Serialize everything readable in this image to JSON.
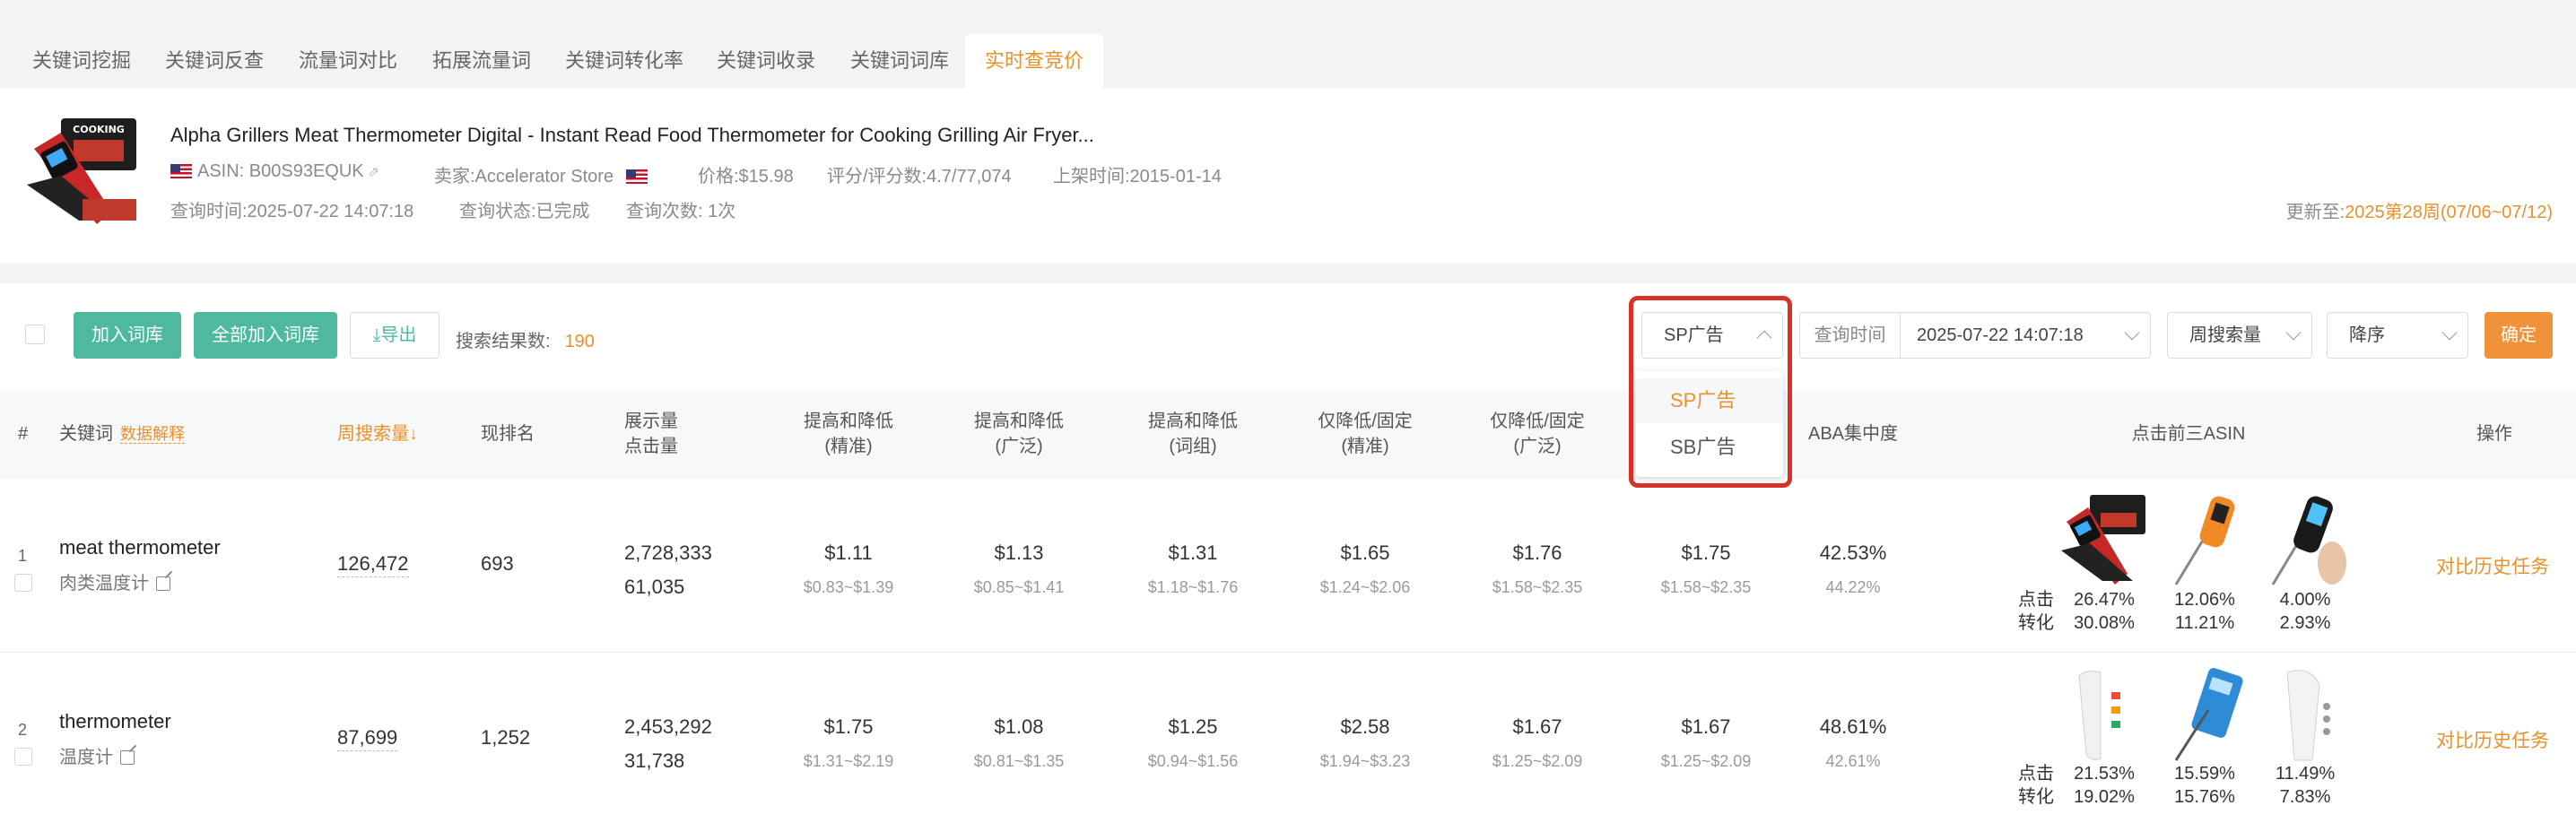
{
  "tabs": [
    "关键词挖掘",
    "关键词反查",
    "流量词对比",
    "拓展流量词",
    "关键词转化率",
    "关键词收录",
    "关键词词库",
    "实时查竞价"
  ],
  "product": {
    "title": "Alpha Grillers Meat Thermometer Digital - Instant Read Food Thermometer for Cooking Grilling Air Fryer...",
    "asin": "ASIN: B00S93EQUK",
    "seller": "卖家:Accelerator Store",
    "price": "价格:$15.98",
    "rating": "评分/评分数:4.7/77,074",
    "listed": "上架时间:2015-01-14",
    "query_time": "查询时间:2025-07-22 14:07:18",
    "query_status": "查询状态:已完成",
    "query_count": "查询次数: 1次",
    "update_label": "更新至:",
    "update_value": "2025第28周(07/06~07/12)"
  },
  "toolbar": {
    "add_label": "加入词库",
    "add_all_label": "全部加入词库",
    "export_label": "导出",
    "count_label": "搜索结果数:",
    "count_value": "190",
    "ad_type": "SP广告",
    "query_time_label": "查询时间",
    "query_time_value": "2025-07-22 14:07:18",
    "sort_field": "周搜索量",
    "sort_order": "降序",
    "confirm_label": "确定"
  },
  "dropdown": {
    "options": [
      "SP广告",
      "SB广告"
    ],
    "selected": "SP广告"
  },
  "columns": {
    "num": "#",
    "keyword": "关键词",
    "keyword_tip": "数据解释",
    "weekly": "周搜索量↓",
    "rank": "现排名",
    "impr1": "展示量",
    "impr2": "点击量",
    "exact1": "提高和降低",
    "exact2": "(精准)",
    "broad1": "提高和降低",
    "broad2": "(广泛)",
    "phrase1": "提高和降低",
    "phrase2": "(词组)",
    "fexact1": "仅降低/固定",
    "fexact2": "(精准)",
    "fbroad1": "仅降低/固定",
    "fbroad2": "(广泛)",
    "aba": "ABA集中度",
    "top3": "点击前三ASIN",
    "action": "操作"
  },
  "rows": [
    {
      "idx": "1",
      "keyword": "meat thermometer",
      "keyword_cn": "肉类温度计",
      "weekly": "126,472",
      "rank": "693",
      "impressions": "2,728,333",
      "clicks": "61,035",
      "exact": "$1.11",
      "exact_range": "$0.83~$1.39",
      "broad": "$1.13",
      "broad_range": "$0.85~$1.41",
      "phrase": "$1.31",
      "phrase_range": "$1.18~$1.76",
      "fexact": "$1.65",
      "fexact_range": "$1.24~$2.06",
      "fbroad": "$1.76",
      "fbroad_range": "$1.58~$2.35",
      "fphrase": "$1.75",
      "fphrase_range": "$1.58~$2.35",
      "aba": "42.53%",
      "aba_sub": "44.22%",
      "click_label": "点击",
      "conv_label": "转化",
      "asins": [
        {
          "click": "26.47%",
          "conv": "30.08%"
        },
        {
          "click": "12.06%",
          "conv": "11.21%"
        },
        {
          "click": "4.00%",
          "conv": "2.93%"
        }
      ],
      "action": "对比历史任务"
    },
    {
      "idx": "2",
      "keyword": "thermometer",
      "keyword_cn": "温度计",
      "weekly": "87,699",
      "rank": "1,252",
      "impressions": "2,453,292",
      "clicks": "31,738",
      "exact": "$1.75",
      "exact_range": "$1.31~$2.19",
      "broad": "$1.08",
      "broad_range": "$0.81~$1.35",
      "phrase": "$1.25",
      "phrase_range": "$0.94~$1.56",
      "fexact": "$2.58",
      "fexact_range": "$1.94~$3.23",
      "fbroad": "$1.67",
      "fbroad_range": "$1.25~$2.09",
      "fphrase": "$1.67",
      "fphrase_range": "$1.25~$2.09",
      "aba": "48.61%",
      "aba_sub": "42.61%",
      "click_label": "点击",
      "conv_label": "转化",
      "asins": [
        {
          "click": "21.53%",
          "conv": "19.02%"
        },
        {
          "click": "15.59%",
          "conv": "15.76%"
        },
        {
          "click": "11.49%",
          "conv": "7.83%"
        }
      ],
      "action": "对比历史任务"
    }
  ],
  "colors": {
    "accent": "#e8912a",
    "green": "#4fb99f",
    "highlight": "#d7322a"
  }
}
